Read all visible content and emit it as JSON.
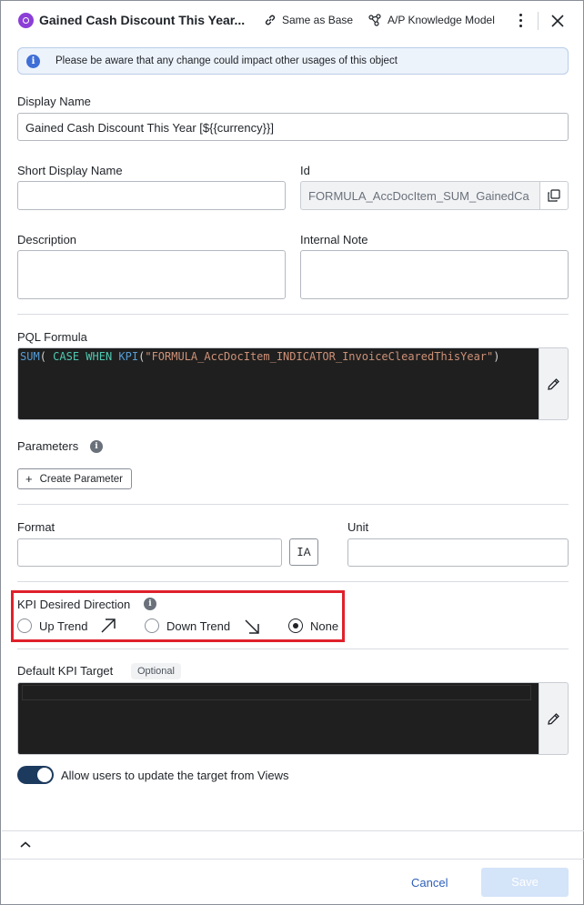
{
  "header": {
    "title": "Gained Cash Discount This Year...",
    "same_as_base_label": "Same as Base",
    "knowledge_model_label": "A/P Knowledge Model"
  },
  "banner": {
    "text": "Please be aware that any change could impact other usages of this object"
  },
  "fields": {
    "display_name_label": "Display Name",
    "display_name_value": "Gained Cash Discount This Year [${{currency}}]",
    "short_display_name_label": "Short Display Name",
    "short_display_name_value": "",
    "id_label": "Id",
    "id_value": "FORMULA_AccDocItem_SUM_GainedCa",
    "description_label": "Description",
    "internal_note_label": "Internal Note"
  },
  "pql": {
    "label": "PQL Formula",
    "tokens": {
      "fn": "SUM",
      "p1": "( ",
      "kw1": "CASE",
      "sp1": " ",
      "kw2": "WHEN",
      "sp2": " ",
      "fn2": "KPI",
      "p2": "(",
      "str": "\"FORMULA_AccDocItem_INDICATOR_InvoiceClearedThisYear\"",
      "p3": ")"
    }
  },
  "parameters": {
    "label": "Parameters",
    "create_label": "Create Parameter"
  },
  "format": {
    "format_label": "Format",
    "format_value": "",
    "unit_label": "Unit",
    "unit_value": "",
    "format_button_label": "A"
  },
  "kpi_direction": {
    "label": "KPI Desired Direction",
    "options": [
      {
        "label": "Up Trend",
        "checked": false
      },
      {
        "label": "Down Trend",
        "checked": false
      },
      {
        "label": "None",
        "checked": true
      }
    ]
  },
  "kpi_target": {
    "label": "Default KPI Target",
    "badge": "Optional"
  },
  "toggle": {
    "label": "Allow users to update the target from Views",
    "on": true
  },
  "footer": {
    "cancel_label": "Cancel",
    "save_label": "Save"
  },
  "colors": {
    "accent": "#1c3a5e",
    "highlight": "#e0212b",
    "link": "#2d5fb8"
  },
  "icons": {
    "header": "formula-icon",
    "same_as_base": "link-icon",
    "knowledge_model": "graph-icon",
    "more": "kebab-icon",
    "close": "close-icon",
    "info": "info-icon",
    "copy": "copy-icon",
    "edit": "pencil-icon",
    "format": "text-format-icon",
    "up": "arrow-up-right-icon",
    "down": "arrow-down-right-icon",
    "collapse": "chevron-up-icon"
  }
}
